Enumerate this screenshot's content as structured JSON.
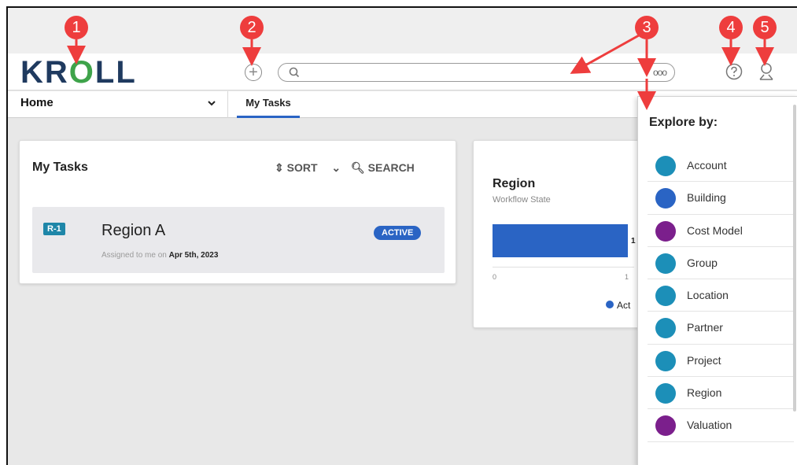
{
  "header": {
    "logo": {
      "prefix": "KR",
      "o": "O",
      "suffix": "LL"
    },
    "add_symbol": "+",
    "search_options_glyph": "ooo"
  },
  "nav": {
    "home_label": "Home",
    "tab_label": "My Tasks"
  },
  "tasks_card": {
    "title": "My Tasks",
    "sort_label": "SORT",
    "search_label": "SEARCH",
    "task": {
      "id": "R-1",
      "name": "Region A",
      "assigned_prefix": "Assigned to me on",
      "assigned_date": "Apr 5th, 2023",
      "status": "ACTIVE"
    }
  },
  "region_card": {
    "title": "Region",
    "subtitle": "Workflow State",
    "bar_value_label": "1",
    "tick_0": "0",
    "tick_1": "1",
    "legend_label": "Act"
  },
  "chart_data": {
    "type": "bar",
    "title": "Region",
    "subtitle": "Workflow State",
    "categories": [
      ""
    ],
    "series": [
      {
        "name": "Act",
        "values": [
          1
        ]
      }
    ],
    "xlim": [
      0,
      1
    ],
    "orientation": "horizontal"
  },
  "explore_panel": {
    "title": "Explore by:",
    "items": [
      {
        "label": "Account",
        "color": "#1c8fb8"
      },
      {
        "label": "Building",
        "color": "#2a64c4"
      },
      {
        "label": "Cost Model",
        "color": "#7b1f8c"
      },
      {
        "label": "Group",
        "color": "#1c8fb8"
      },
      {
        "label": "Location",
        "color": "#1c8fb8"
      },
      {
        "label": "Partner",
        "color": "#1c8fb8"
      },
      {
        "label": "Project",
        "color": "#1c8fb8"
      },
      {
        "label": "Region",
        "color": "#1c8fb8"
      },
      {
        "label": "Valuation",
        "color": "#7b1f8c"
      }
    ]
  },
  "callouts": [
    "1",
    "2",
    "3",
    "4",
    "5"
  ],
  "colors": {
    "accent": "#2a64c4",
    "callout": "#ee3d3d",
    "logo_dark": "#1f3a5f",
    "logo_green": "#3ea34a"
  }
}
